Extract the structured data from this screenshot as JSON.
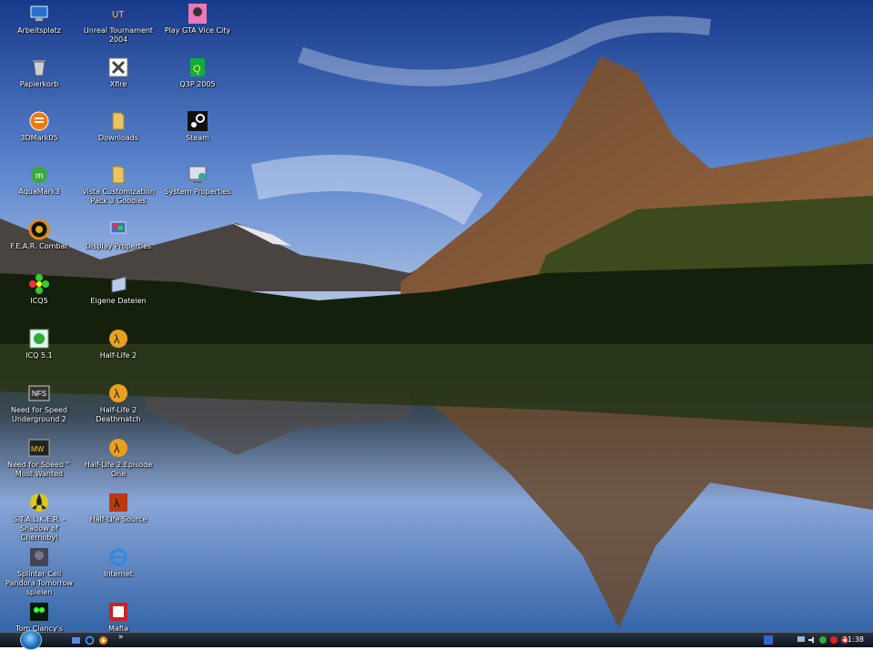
{
  "desktop": {
    "icons": [
      {
        "label": "Arbeitsplatz",
        "icon": "computer-icon"
      },
      {
        "label": "Papierkorb",
        "icon": "recycle-bin-icon"
      },
      {
        "label": "3DMark05",
        "icon": "3dmark-icon"
      },
      {
        "label": "AquaMark3",
        "icon": "aquamark-icon"
      },
      {
        "label": "F.E.A.R. Combat",
        "icon": "fear-icon"
      },
      {
        "label": "ICQ5",
        "icon": "icq-flower-icon"
      },
      {
        "label": "ICQ 5.1",
        "icon": "icq-icon"
      },
      {
        "label": "Need for Speed Underground 2",
        "icon": "nfs-underground-icon"
      },
      {
        "label": "Need for Speed™ Most Wanted",
        "icon": "nfs-most-wanted-icon"
      },
      {
        "label": "S.T.A.L.K.E.R. - Shadow of Chernobyl",
        "icon": "stalker-icon"
      },
      {
        "label": "Splinter Cell Pandora Tomorrow spielen",
        "icon": "splinter-cell-icon"
      },
      {
        "label": "Tom Clancy's Splinter",
        "icon": "splinter-cell-chaos-icon"
      },
      {
        "label": "Unreal Tournament 2004",
        "icon": "unreal-tournament-icon"
      },
      {
        "label": "Xfire",
        "icon": "xfire-icon"
      },
      {
        "label": "Downloads",
        "icon": "folder-icon"
      },
      {
        "label": "Vista Customization Pack 3 Goodies",
        "icon": "folder-icon"
      },
      {
        "label": "Display Properties",
        "icon": "display-properties-icon"
      },
      {
        "label": "Eigene Dateien",
        "icon": "my-documents-icon"
      },
      {
        "label": "Half-Life 2",
        "icon": "half-life-icon"
      },
      {
        "label": "Half-Life 2 Deathmatch",
        "icon": "half-life-icon"
      },
      {
        "label": "Half-Life 2 Episode One",
        "icon": "half-life-icon"
      },
      {
        "label": "Half-Life Source",
        "icon": "half-life-source-icon"
      },
      {
        "label": "Internet",
        "icon": "internet-explorer-icon"
      },
      {
        "label": "Mafia",
        "icon": "mafia-icon"
      },
      {
        "label": "Play GTA Vice City",
        "icon": "gta-vice-city-icon"
      },
      {
        "label": "Q3P 2005",
        "icon": "q3p-icon"
      },
      {
        "label": "Steam",
        "icon": "steam-icon"
      },
      {
        "label": "System Properties",
        "icon": "system-properties-icon"
      }
    ]
  },
  "taskbar": {
    "clock": "11:38",
    "quick_launch": [
      "desktop-icon",
      "internet-explorer-icon",
      "media-player-icon"
    ],
    "chevron": "»",
    "tray_icons": [
      "language-icon",
      "network-icon",
      "volume-icon",
      "security-icon",
      "antivirus-icon",
      "update-icon"
    ]
  },
  "colors": {
    "taskbar": "#1a222e",
    "sky": "#4a74c4"
  }
}
